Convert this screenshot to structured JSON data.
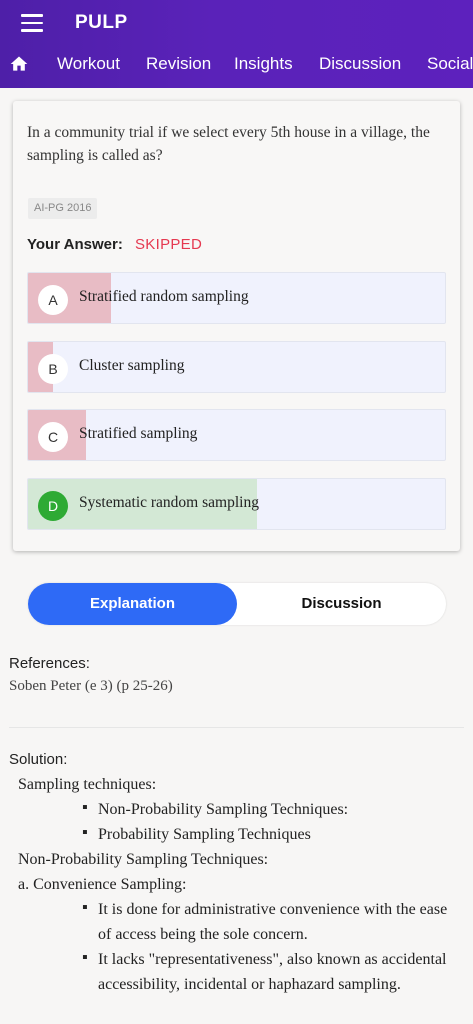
{
  "app": {
    "title": "PULP",
    "menu_icon": "hamburger-menu-icon",
    "home_icon": "home-icon"
  },
  "nav": {
    "tabs": [
      "Workout",
      "Revision",
      "Insights",
      "Discussion",
      "Social"
    ]
  },
  "question": {
    "text": "In a community trial if we select every 5th house in a village, the sampling is called as?",
    "tag": "AI-PG 2016",
    "your_answer_label": "Your Answer:",
    "your_answer_value": "SKIPPED",
    "options": [
      {
        "letter": "A",
        "text": "Stratified random sampling",
        "percent": 20,
        "correct": false
      },
      {
        "letter": "B",
        "text": "Cluster sampling",
        "percent": 6,
        "correct": false
      },
      {
        "letter": "C",
        "text": "Stratified sampling",
        "percent": 14,
        "correct": false
      },
      {
        "letter": "D",
        "text": "Systematic random sampling",
        "percent": 55,
        "correct": true
      }
    ]
  },
  "toggle": {
    "explanation": "Explanation",
    "discussion": "Discussion"
  },
  "references": {
    "heading": "References:",
    "text": "Soben Peter (e 3) (p 25-26)"
  },
  "solution": {
    "heading": "Solution:",
    "line1": "Sampling techniques:",
    "b1": "Non-Probability Sampling Techniques:",
    "b2": "Probability Sampling Techniques",
    "line2": "Non-Probability Sampling Techniques:",
    "line3": "a. Convenience Sampling:",
    "b3": "It is done for administrative convenience with the ease of access being the sole concern.",
    "b4": "It lacks \"representativeness\", also known as accidental accessibility, incidental or haphazard sampling."
  },
  "colors": {
    "header": "#5a22b9",
    "accent": "#2e6af6",
    "wrong": "#e8bcc5",
    "right": "#d3e8d5",
    "skipped": "#e53950",
    "correct_badge": "#2eaa34"
  }
}
